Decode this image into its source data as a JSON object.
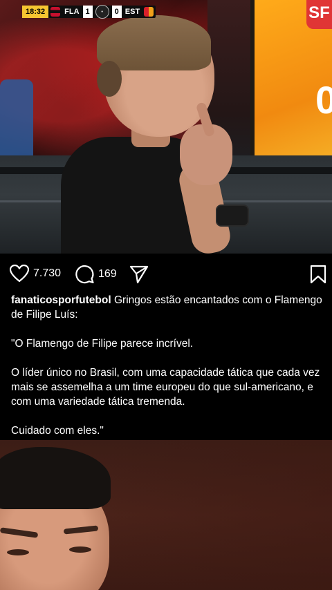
{
  "scorebug": {
    "time": "18:32",
    "home_team": "FLA",
    "home_score": "1",
    "away_score": "0",
    "away_team": "EST"
  },
  "overlay_logo": "SF",
  "screen_digit": "0",
  "actions": {
    "likes": "7.730",
    "comments": "169"
  },
  "post": {
    "username": "fanaticosporfutebol",
    "caption_lead": "Gringos estão encantados com o Flamengo de Filipe Luís:",
    "paragraphs": [
      "\"O Flamengo de Filipe parece incrível.",
      "O líder único no Brasil, com uma capacidade tática que cada vez mais se assemelha a um time europeu do que sul-americano, e com uma variedade tática tremenda.",
      "Cuidado com eles.\""
    ]
  },
  "icons": {
    "like": "heart-icon",
    "comment": "comment-bubble-icon",
    "share": "paper-plane-icon",
    "save": "bookmark-icon"
  },
  "colors": {
    "background": "#000000",
    "text": "#ffffff",
    "score_time_bg": "#f6c531",
    "logo_red": "#e03535"
  }
}
